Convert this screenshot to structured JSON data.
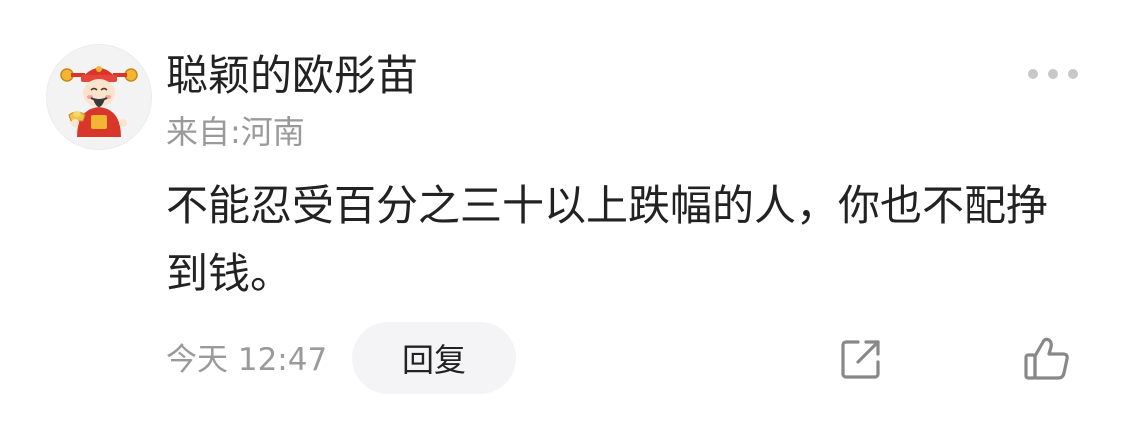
{
  "comment": {
    "username": "聪颖的欧彤苗",
    "location": "来自:河南",
    "text": "不能忍受百分之三十以上跌幅的人，你也不配挣到钱。",
    "time": "今天 12:47",
    "reply_label": "回复",
    "avatar_icon": "caishen-avatar",
    "more_icon": "more-dots-icon",
    "share_icon": "share-icon",
    "like_icon": "thumbs-up-icon"
  },
  "colors": {
    "text_primary": "#222222",
    "text_secondary": "#9a9a9a",
    "reply_bg": "#f4f4f6",
    "icon": "#888888"
  }
}
